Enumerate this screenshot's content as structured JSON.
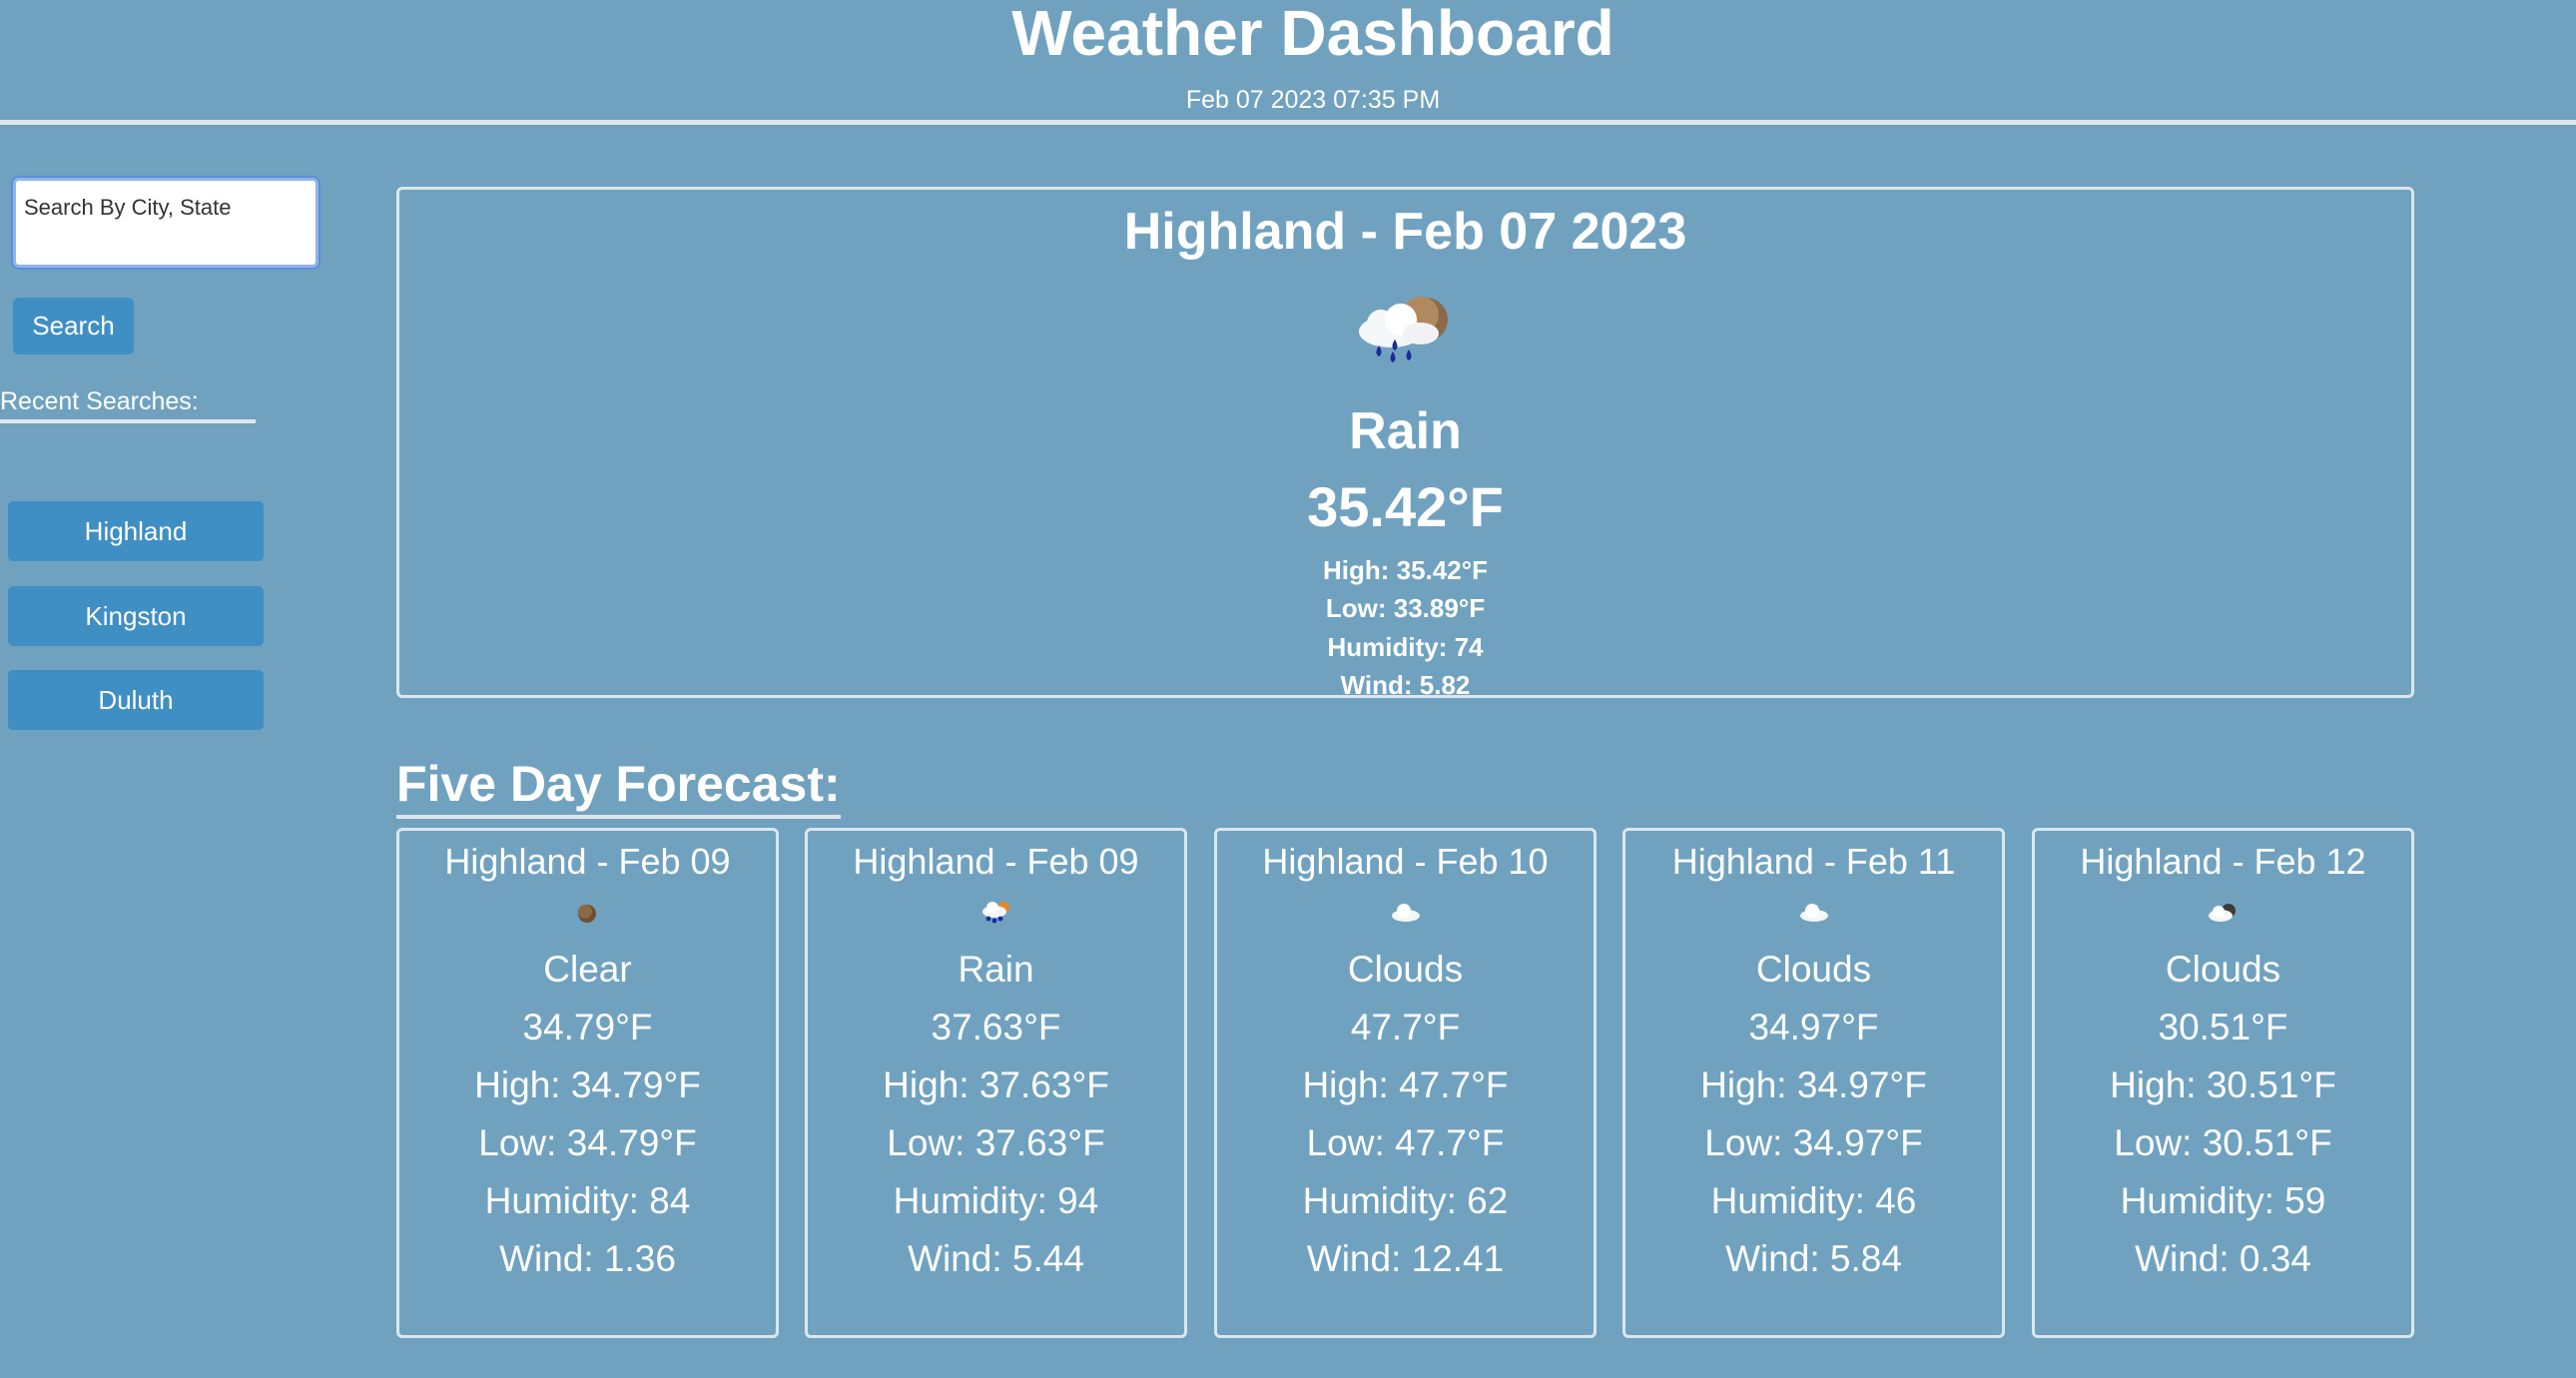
{
  "header": {
    "title": "Weather Dashboard",
    "datetime": "Feb 07 2023 07:35 PM"
  },
  "sidebar": {
    "search_placeholder": "Search By City, State",
    "search_button": "Search",
    "recent_label": "Recent Searches:",
    "recent": [
      "Highland",
      "Kingston",
      "Duluth"
    ]
  },
  "current": {
    "title": "Highland - Feb 07 2023",
    "icon": "rain-cloud-icon",
    "condition": "Rain",
    "temp": "35.42°F",
    "high": "High: 35.42°F",
    "low": "Low: 33.89°F",
    "humidity": "Humidity: 74",
    "wind": "Wind: 5.82"
  },
  "forecast": {
    "heading": "Five Day Forecast:",
    "days": [
      {
        "title": "Highland - Feb 09",
        "icon": "clear-night-icon",
        "condition": "Clear",
        "temp": "34.79°F",
        "high": "High: 34.79°F",
        "low": "Low: 34.79°F",
        "humidity": "Humidity: 84",
        "wind": "Wind: 1.36"
      },
      {
        "title": "Highland - Feb 09",
        "icon": "rain-cloud-icon",
        "condition": "Rain",
        "temp": "37.63°F",
        "high": "High: 37.63°F",
        "low": "Low: 37.63°F",
        "humidity": "Humidity: 94",
        "wind": "Wind: 5.44"
      },
      {
        "title": "Highland - Feb 10",
        "icon": "cloud-icon",
        "condition": "Clouds",
        "temp": "47.7°F",
        "high": "High: 47.7°F",
        "low": "Low: 47.7°F",
        "humidity": "Humidity: 62",
        "wind": "Wind: 12.41"
      },
      {
        "title": "Highland - Feb 11",
        "icon": "cloud-icon",
        "condition": "Clouds",
        "temp": "34.97°F",
        "high": "High: 34.97°F",
        "low": "Low: 34.97°F",
        "humidity": "Humidity: 46",
        "wind": "Wind: 5.84"
      },
      {
        "title": "Highland - Feb 12",
        "icon": "cloudy-night-icon",
        "condition": "Clouds",
        "temp": "30.51°F",
        "high": "High: 30.51°F",
        "low": "Low: 30.51°F",
        "humidity": "Humidity: 59",
        "wind": "Wind: 0.34"
      }
    ]
  },
  "colors": {
    "background": "#70a2c0",
    "button": "#3f8fc4",
    "border": "#dbe6ee"
  }
}
